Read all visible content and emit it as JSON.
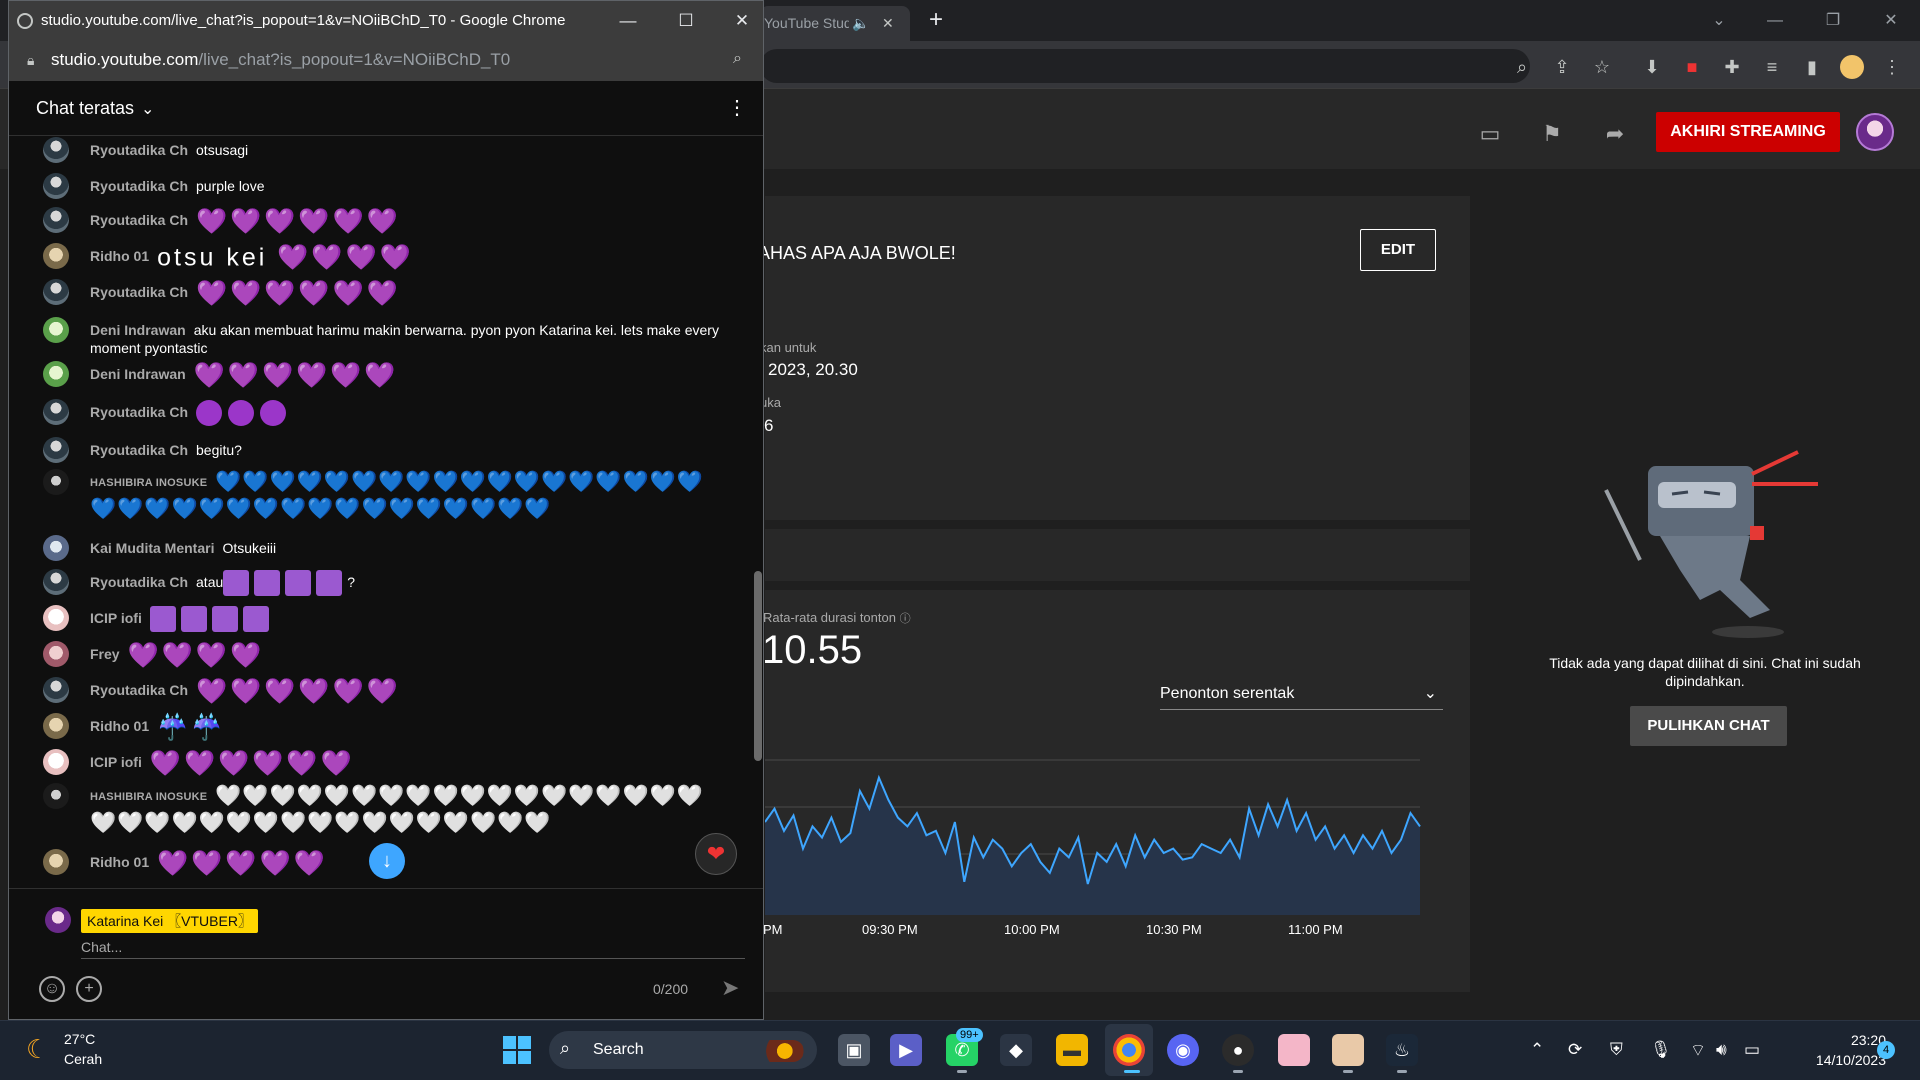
{
  "background_browser": {
    "tab_title": "YouTube Studio",
    "studio": {
      "end_stream_label": "AKHIRI STREAMING",
      "stream_title": "AHAS APA AJA BWOLE!",
      "edit_label": "EDIT",
      "scheduled_label": "kan untuk",
      "scheduled_value": "2023, 20.30",
      "likes_label": "uka",
      "likes_value": "6",
      "avg_watch_label": "Rata-rata durasi tonton",
      "avg_watch_value": "10.55",
      "metric_select": "Penonton serentak",
      "chart_x_ticks": [
        "PM",
        "09:30 PM",
        "10:00 PM",
        "10:30 PM",
        "11:00 PM"
      ],
      "chat_disabled_message": "Tidak ada yang dapat dilihat di sini. Chat ini sudah dipindahkan.",
      "restore_chat_label": "PULIHKAN CHAT"
    }
  },
  "popup": {
    "window_title": "studio.youtube.com/live_chat?is_popout=1&v=NOiiBChD_T0 - Google Chrome",
    "url_host": "studio.youtube.com",
    "url_path": "/live_chat?is_popout=1&v=NOiiBChD_T0",
    "chat_mode": "Chat teratas",
    "messages": [
      {
        "author": "Ryoutadika Ch",
        "text": "otsusagi"
      },
      {
        "author": "Ryoutadika Ch",
        "text": "purple love"
      },
      {
        "author": "Ryoutadika Ch",
        "text": "💜💜💜💜💜💜"
      },
      {
        "author": "Ridho 01",
        "text": "otsu kei 💜💜💜💜"
      },
      {
        "author": "Ryoutadika Ch",
        "text": "💜💜💜💜💜💜"
      },
      {
        "author": "Deni Indrawan",
        "text": "aku akan membuat harimu makin berwarna. pyon pyon Katarina kei. lets make every moment pyontastic"
      },
      {
        "author": "Deni Indrawan",
        "text": "💜💜💜💜💜💜"
      },
      {
        "author": "Ryoutadika Ch",
        "text": ""
      },
      {
        "author": "Ryoutadika Ch",
        "text": "begitu?"
      },
      {
        "author": "HASHIBIRA INOSUKE",
        "text": "💙💙💙💙💙💙💙💙💙💙💙💙💙💙💙💙💙💙💙💙💙💙💙💙💙💙💙💙💙💙💙💙💙💙💙"
      },
      {
        "author": "Kai Mudita Mentari",
        "text": "Otsukeiii"
      },
      {
        "author": "Ryoutadika Ch",
        "text": "atau",
        "suffix": "?"
      },
      {
        "author": "ICIP iofi",
        "text": ""
      },
      {
        "author": "Frey",
        "text": "💜💜💜💜"
      },
      {
        "author": "Ryoutadika Ch",
        "text": "💜💜💜💜💜💜"
      },
      {
        "author": "Ridho 01",
        "text": "☔☔"
      },
      {
        "author": "ICIP iofi",
        "text": "💜💜💜💜💜💜"
      },
      {
        "author": "HASHIBIRA INOSUKE",
        "text": "🤍🤍🤍🤍🤍🤍🤍🤍🤍🤍🤍🤍🤍🤍🤍🤍🤍🤍🤍🤍🤍🤍🤍🤍🤍🤍🤍🤍🤍🤍🤍🤍🤍🤍🤍"
      },
      {
        "author": "Ridho 01",
        "text": "💜💜💜💜💜"
      }
    ],
    "self_name": "Katarina Kei 〖VTUBER〗",
    "input_placeholder": "Chat...",
    "char_count": "0/200"
  },
  "taskbar": {
    "weather_temp": "27°C",
    "weather_condition": "Cerah",
    "search_label": "Search",
    "whatsapp_badge": "99+",
    "clock_time": "23:20",
    "clock_date": "14/10/2023",
    "notification_count": "4"
  },
  "chart_data": {
    "type": "line",
    "title": "",
    "xlabel": "",
    "ylabel": "",
    "x_ticks": [
      "PM",
      "09:30 PM",
      "10:00 PM",
      "10:30 PM",
      "11:00 PM"
    ],
    "series": [
      {
        "values": [
          42,
          48,
          38,
          45,
          30,
          40,
          35,
          44,
          33,
          37,
          56,
          48,
          62,
          52,
          44,
          40,
          46,
          36,
          38,
          28,
          42,
          15,
          35,
          26,
          34,
          30,
          22,
          28,
          32,
          24,
          19,
          30,
          26,
          35,
          14,
          28,
          24,
          32,
          22,
          36,
          26,
          34,
          28,
          30,
          25,
          26,
          32,
          30,
          28,
          34,
          26,
          48,
          36,
          50,
          40,
          52,
          38,
          46,
          34,
          40,
          30,
          36,
          28,
          36,
          30,
          38,
          28,
          34,
          46,
          40
        ]
      }
    ],
    "colors": {
      "line": "#3ea6ff",
      "fill": "#26344a"
    }
  },
  "colors": {
    "accent_red": "#cc0000",
    "link_blue": "#3ea6ff",
    "self_name_bg": "#ffd600"
  }
}
